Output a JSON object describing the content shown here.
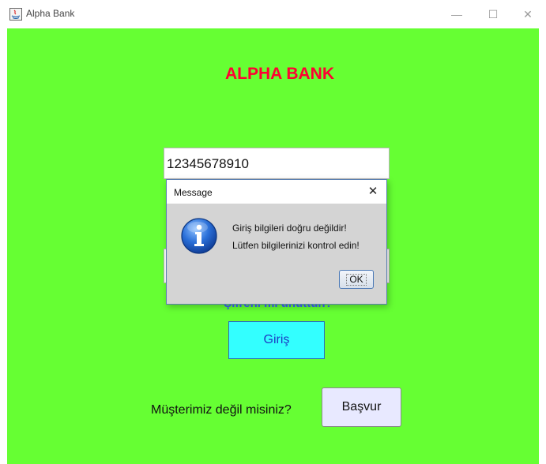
{
  "window": {
    "title": "Alpha Bank",
    "controls": {
      "minimize": "—",
      "maximize": "☐",
      "close": "✕"
    }
  },
  "main": {
    "bank_name": "ALPHA BANK",
    "customer_id_value": "12345678910",
    "forgot_password_label": "Şifreni mi unuttun?",
    "login_label": "Giriş",
    "not_customer_text": "Müşterimiz değil misiniz?",
    "apply_label": "Başvur"
  },
  "dialog": {
    "title": "Message",
    "close_glyph": "✕",
    "message_line1": "Giriş bilgileri doğru değildir!",
    "message_line2": "Lütfen bilgilerinizi kontrol edin!",
    "ok_label": "OK",
    "icon": "info-icon"
  },
  "colors": {
    "background": "#66ff33",
    "title": "#ff0033",
    "login_button": "#33ffff",
    "link": "#3b5bff",
    "apply_button": "#e8e9ff",
    "dialog": "#d4d4d4"
  }
}
